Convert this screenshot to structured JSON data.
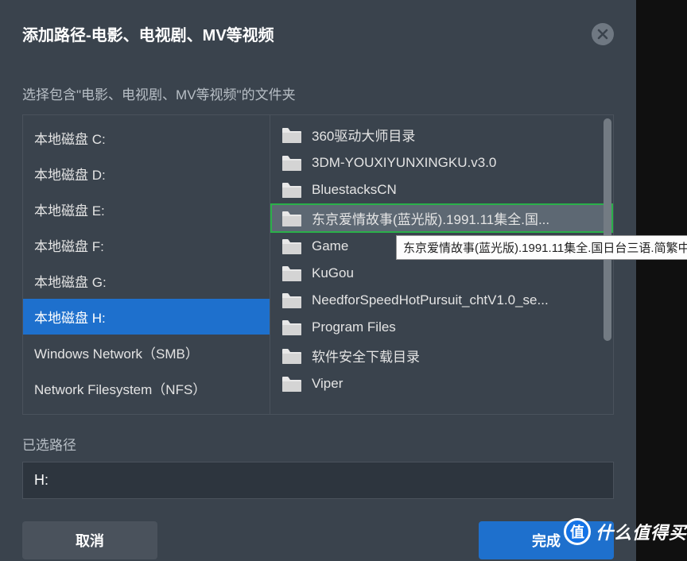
{
  "dialog": {
    "title": "添加路径-电影、电视剧、MV等视频",
    "subtitle": "选择包含\"电影、电视剧、MV等视频\"的文件夹",
    "close": "×"
  },
  "drives": [
    {
      "label": "本地磁盘 C:",
      "selected": false
    },
    {
      "label": "本地磁盘 D:",
      "selected": false
    },
    {
      "label": "本地磁盘 E:",
      "selected": false
    },
    {
      "label": "本地磁盘 F:",
      "selected": false
    },
    {
      "label": "本地磁盘 G:",
      "selected": false
    },
    {
      "label": "本地磁盘 H:",
      "selected": true
    },
    {
      "label": "Windows Network（SMB）",
      "selected": false
    },
    {
      "label": "Network Filesystem（NFS）",
      "selected": false
    }
  ],
  "folders": [
    {
      "label": "360驱动大师目录",
      "highlighted": false
    },
    {
      "label": "3DM-YOUXIYUNXINGKU.v3.0",
      "highlighted": false
    },
    {
      "label": "BluestacksCN",
      "highlighted": false
    },
    {
      "label": "东京爱情故事(蓝光版).1991.11集全.国...",
      "highlighted": true
    },
    {
      "label": "Game",
      "highlighted": false
    },
    {
      "label": "KuGou",
      "highlighted": false
    },
    {
      "label": "NeedforSpeedHotPursuit_chtV1.0_se...",
      "highlighted": false
    },
    {
      "label": "Program Files",
      "highlighted": false
    },
    {
      "label": "软件安全下载目录",
      "highlighted": false
    },
    {
      "label": "Viper",
      "highlighted": false
    }
  ],
  "tooltip": "东京爱情故事(蓝光版).1991.11集全.国日台三语.简繁中",
  "selected_path": {
    "label": "已选路径",
    "value": "H:"
  },
  "buttons": {
    "cancel": "取消",
    "confirm": "完成"
  },
  "watermark": {
    "icon": "值",
    "text": "什么值得买"
  }
}
